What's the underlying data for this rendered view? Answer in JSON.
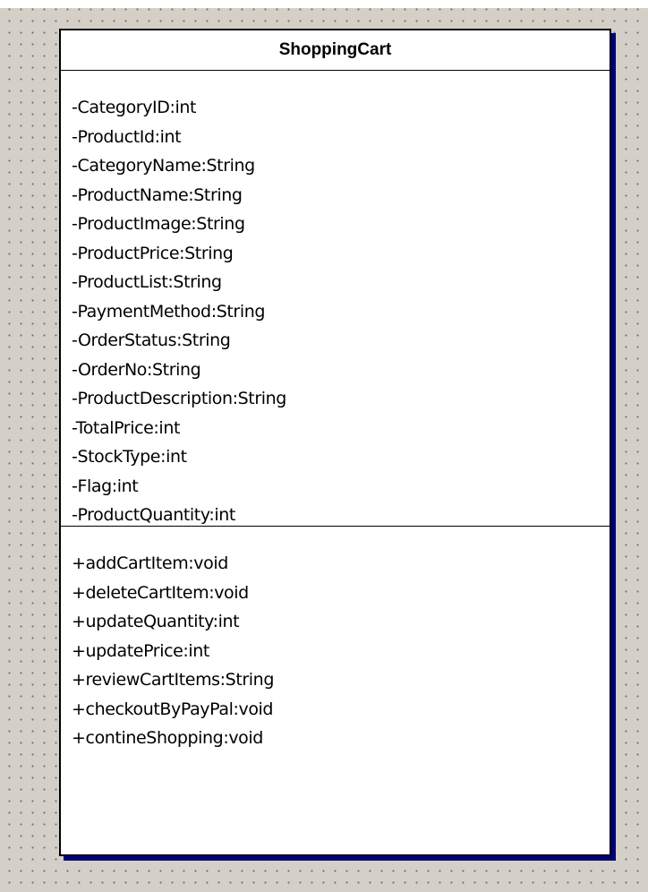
{
  "diagram": {
    "type": "uml-class",
    "class_name": "ShoppingCart",
    "attributes": [
      "-CategoryID:int",
      "-ProductId:int",
      "-CategoryName:String",
      "-ProductName:String",
      "-ProductImage:String",
      "-ProductPrice:String",
      "-ProductList:String",
      "-PaymentMethod:String",
      "-OrderStatus:String",
      "-OrderNo:String",
      "-ProductDescription:String",
      "-TotalPrice:int",
      "-StockType:int",
      "-Flag:int",
      "-ProductQuantity:int"
    ],
    "operations": [
      "+addCartItem:void",
      "+deleteCartItem:void",
      "+updateQuantity:int",
      "+updatePrice:int",
      "+reviewCartItems:String",
      "+checkoutByPayPal:void",
      "+contineShopping:void"
    ]
  },
  "colors": {
    "canvas_background": "#d4d0c8",
    "grid_dot": "#6e6e6e",
    "box_fill": "#ffffff",
    "box_border": "#000000",
    "box_shadow": "#00007a"
  }
}
